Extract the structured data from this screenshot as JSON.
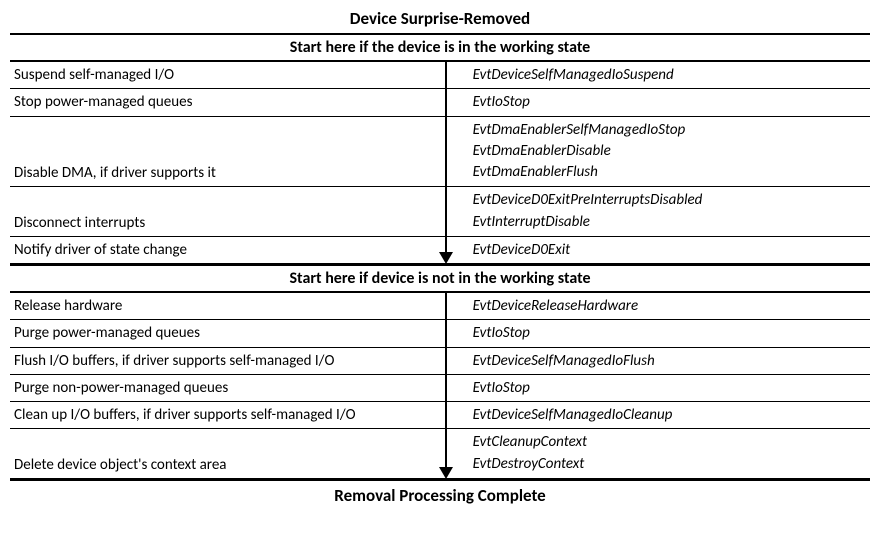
{
  "title": "Device Surprise-Removed",
  "section1_head": "Start here if the device is in the working state",
  "section2_head": "Start here if device is not in the working state",
  "footer": "Removal Processing Complete",
  "section1": [
    {
      "desc": "Suspend self-managed I/O",
      "callbacks": [
        "EvtDeviceSelfManagedIoSuspend"
      ]
    },
    {
      "desc": "Stop power-managed queues",
      "callbacks": [
        "EvtIoStop"
      ]
    },
    {
      "desc": "Disable DMA, if driver supports it",
      "callbacks": [
        "EvtDmaEnablerSelfManagedIoStop",
        "EvtDmaEnablerDisable",
        "EvtDmaEnablerFlush"
      ]
    },
    {
      "desc": "Disconnect interrupts",
      "callbacks": [
        "EvtDeviceD0ExitPreInterruptsDisabled",
        "EvtInterruptDisable"
      ]
    },
    {
      "desc": "Notify driver of state change",
      "callbacks": [
        "EvtDeviceD0Exit"
      ]
    }
  ],
  "section2": [
    {
      "desc": "Release hardware",
      "callbacks": [
        "EvtDeviceReleaseHardware"
      ]
    },
    {
      "desc": "Purge power-managed queues",
      "callbacks": [
        "EvtIoStop"
      ]
    },
    {
      "desc": "Flush I/O buffers, if driver supports self-managed I/O",
      "callbacks": [
        "EvtDeviceSelfManagedIoFlush"
      ]
    },
    {
      "desc": "Purge non-power-managed queues",
      "callbacks": [
        "EvtIoStop"
      ]
    },
    {
      "desc": "Clean up I/O buffers, if driver supports self-managed I/O",
      "callbacks": [
        "EvtDeviceSelfManagedIoCleanup"
      ]
    },
    {
      "desc": "Delete device object's context area",
      "callbacks": [
        "EvtCleanupContext",
        "EvtDestroyContext"
      ]
    }
  ]
}
